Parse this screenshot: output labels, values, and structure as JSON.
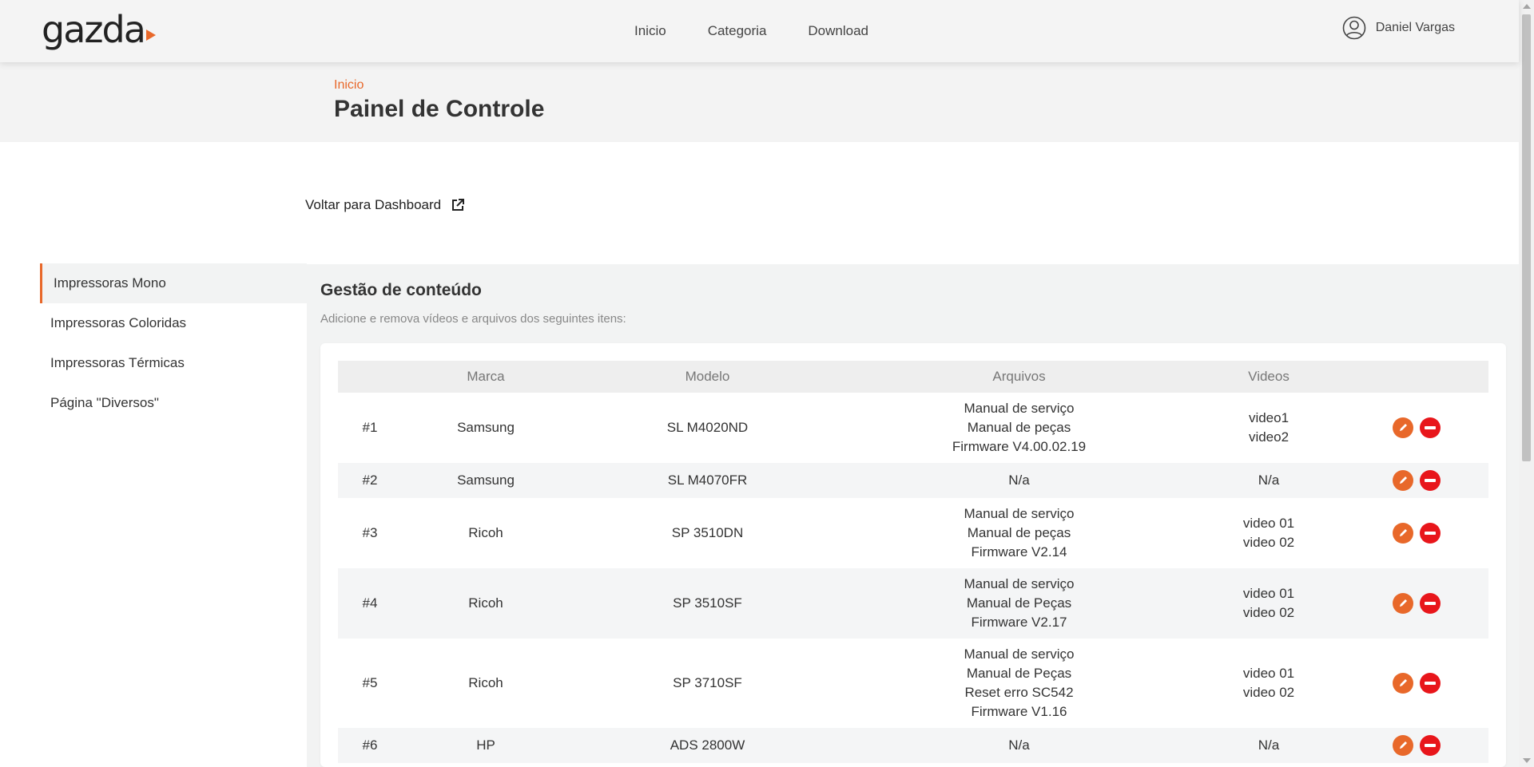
{
  "brand": {
    "logo_text": "gazda",
    "accent": "#e8682a"
  },
  "nav": {
    "items": [
      "Inicio",
      "Categoria",
      "Download"
    ]
  },
  "user": {
    "name": "Daniel Vargas",
    "icon": "user-circle-icon"
  },
  "hero": {
    "breadcrumb": "Inicio",
    "title": "Painel de Controle"
  },
  "back_link": {
    "label": "Voltar para Dashboard",
    "icon": "external-link-icon"
  },
  "sidebar": {
    "items": [
      {
        "label": "Impressoras Mono",
        "active": true
      },
      {
        "label": "Impressoras Coloridas",
        "active": false
      },
      {
        "label": "Impressoras Térmicas",
        "active": false
      },
      {
        "label": "Página \"Diversos\"",
        "active": false
      }
    ]
  },
  "section": {
    "title": "Gestão de conteúdo",
    "subtitle": "Adicione e remova vídeos e arquivos dos seguintes itens:"
  },
  "table": {
    "headers": [
      "",
      "Marca",
      "Modelo",
      "Arquivos",
      "Videos",
      ""
    ],
    "rows": [
      {
        "idx": "#1",
        "marca": "Samsung",
        "modelo": "SL M4020ND",
        "arquivos": [
          "Manual de serviço",
          "Manual de peças",
          "Firmware V4.00.02.19"
        ],
        "videos": [
          "video1",
          "video2"
        ]
      },
      {
        "idx": "#2",
        "marca": "Samsung",
        "modelo": "SL M4070FR",
        "arquivos": [
          "N/a"
        ],
        "videos": [
          "N/a"
        ]
      },
      {
        "idx": "#3",
        "marca": "Ricoh",
        "modelo": "SP 3510DN",
        "arquivos": [
          "Manual de serviço",
          "Manual de peças",
          "Firmware V2.14"
        ],
        "videos": [
          "video 01",
          "video 02"
        ]
      },
      {
        "idx": "#4",
        "marca": "Ricoh",
        "modelo": "SP 3510SF",
        "arquivos": [
          "Manual de serviço",
          "Manual de Peças",
          "Firmware V2.17"
        ],
        "videos": [
          "video 01",
          "video 02"
        ]
      },
      {
        "idx": "#5",
        "marca": "Ricoh",
        "modelo": "SP 3710SF",
        "arquivos": [
          "Manual de serviço",
          "Manual de Peças",
          "Reset erro SC542",
          "Firmware V1.16"
        ],
        "videos": [
          "video 01",
          "video 02"
        ]
      },
      {
        "idx": "#6",
        "marca": "HP",
        "modelo": "ADS 2800W",
        "arquivos": [
          "N/a"
        ],
        "videos": [
          "N/a"
        ]
      }
    ],
    "action_icons": {
      "edit": "pencil-icon",
      "delete": "minus-circle-icon"
    }
  },
  "colors": {
    "edit": "#e8682a",
    "delete": "#e8161b",
    "content_bg": "#f2f3f3"
  }
}
